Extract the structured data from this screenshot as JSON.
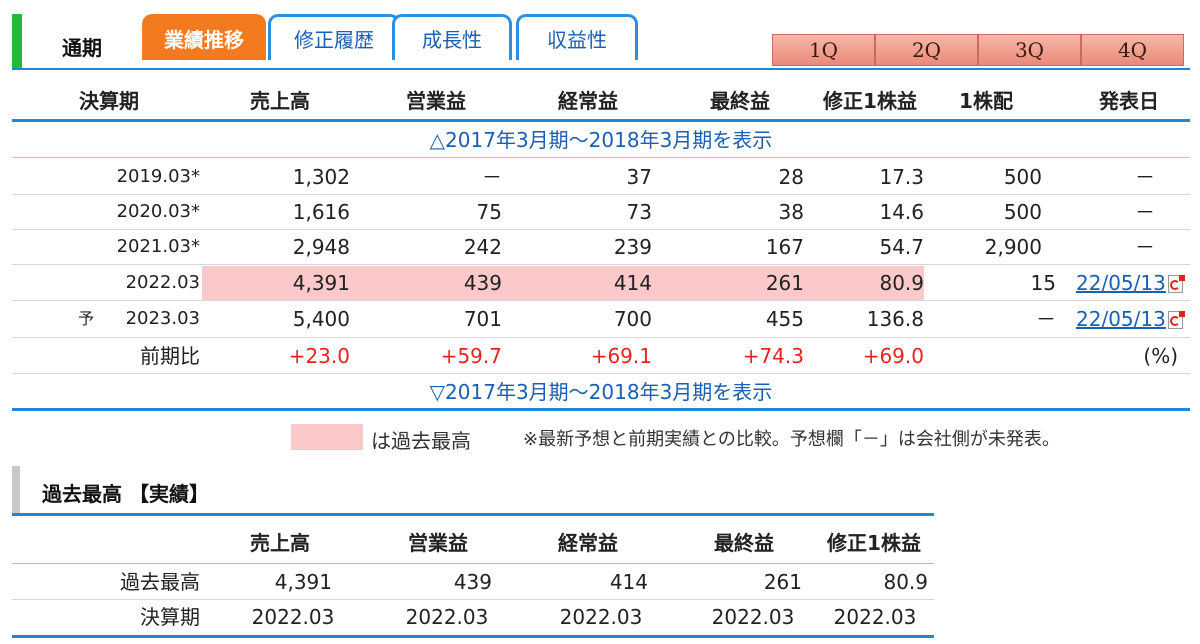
{
  "tabs": {
    "main_label": "通期",
    "items": [
      "業績推移",
      "修正履歴",
      "成長性",
      "収益性"
    ],
    "quarters": [
      "1Q",
      "2Q",
      "3Q",
      "4Q"
    ]
  },
  "table": {
    "headers": [
      "決算期",
      "売上高",
      "営業益",
      "経常益",
      "最終益",
      "修正1株益",
      "1株配",
      "発表日"
    ],
    "toggle_top": "△2017年3月期～2018年3月期を表示",
    "toggle_bottom": "▽2017年3月期～2018年3月期を表示",
    "rows": [
      {
        "period": "2019.03*",
        "prefix": "",
        "sales": "1,302",
        "op": "－",
        "ord": "37",
        "net": "28",
        "eps": "17.3",
        "div": "500",
        "date": "－"
      },
      {
        "period": "2020.03*",
        "prefix": "",
        "sales": "1,616",
        "op": "75",
        "ord": "73",
        "net": "38",
        "eps": "14.6",
        "div": "500",
        "date": "－"
      },
      {
        "period": "2021.03*",
        "prefix": "",
        "sales": "2,948",
        "op": "242",
        "ord": "239",
        "net": "167",
        "eps": "54.7",
        "div": "2,900",
        "date": "－"
      },
      {
        "period": "2022.03",
        "prefix": "",
        "sales": "4,391",
        "op": "439",
        "ord": "414",
        "net": "261",
        "eps": "80.9",
        "div": "15",
        "date": "22/05/13"
      },
      {
        "period": "2023.03",
        "prefix": "予",
        "sales": "5,400",
        "op": "701",
        "ord": "700",
        "net": "455",
        "eps": "136.8",
        "div": "－",
        "date": "22/05/13"
      }
    ],
    "yoy": {
      "label": "前期比",
      "sales": "+23.0",
      "op": "+59.7",
      "ord": "+69.1",
      "net": "+74.3",
      "eps": "+69.0",
      "unit": "(%)"
    }
  },
  "legend": {
    "swatch_text": "は過去最高",
    "note": "※最新予想と前期実績との比較。予想欄「－」は会社側が未発表。"
  },
  "record": {
    "title": "過去最高 【実績】",
    "headers": [
      "売上高",
      "営業益",
      "経常益",
      "最終益",
      "修正1株益"
    ],
    "row1_label": "過去最高",
    "row1": [
      "4,391",
      "439",
      "414",
      "261",
      "80.9"
    ],
    "row2_label": "決算期",
    "row2": [
      "2022.03",
      "2022.03",
      "2022.03",
      "2022.03",
      "2022.03"
    ]
  },
  "colors": {
    "accent": "#1f86d8",
    "active_tab": "#f47a1f",
    "highlight": "#fbc9c9",
    "positive": "#e8231a",
    "brand_mark": "#22bb33"
  }
}
